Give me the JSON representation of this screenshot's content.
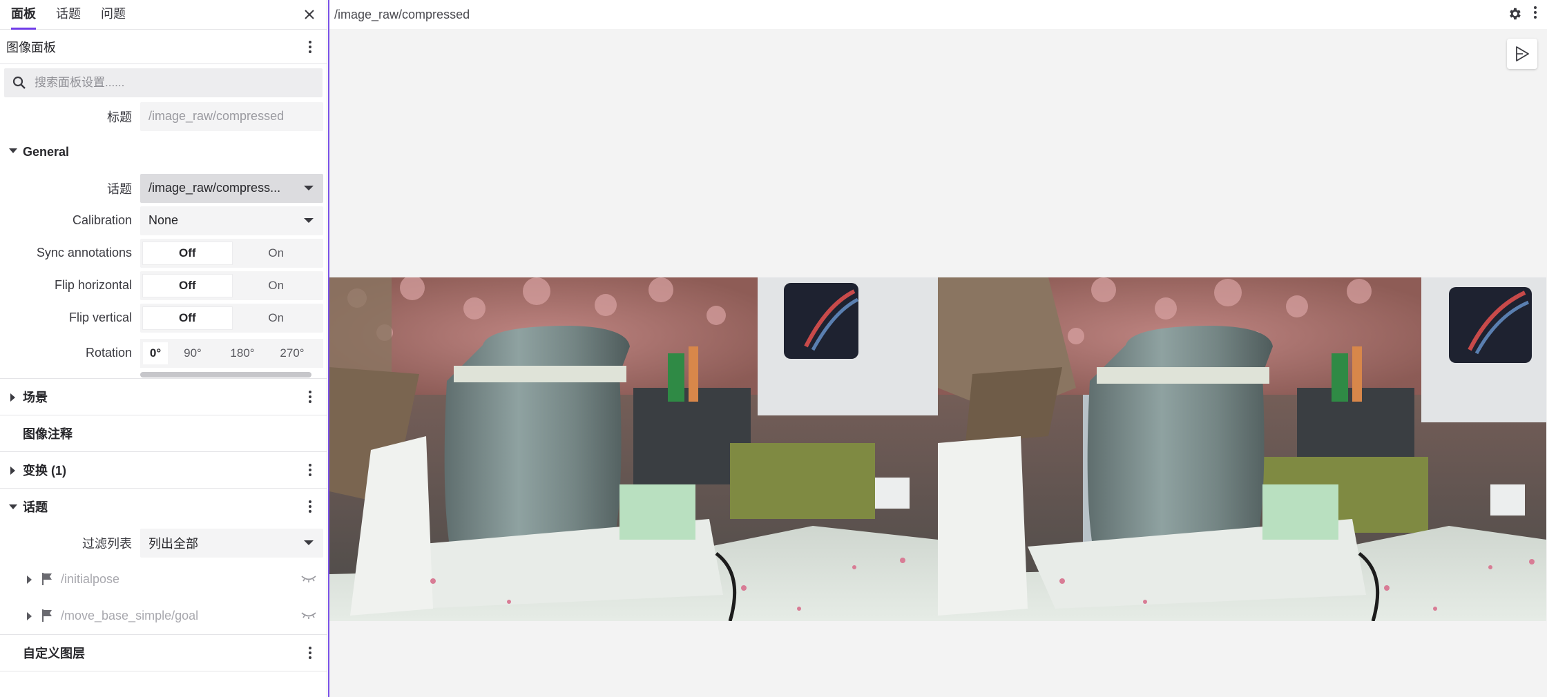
{
  "sidebar": {
    "tabs": [
      "面板",
      "话题",
      "问题"
    ],
    "panel_title": "图像面板",
    "search_placeholder": "搜索面板设置......",
    "title_field": {
      "label": "标题",
      "placeholder": "/image_raw/compressed"
    },
    "general": {
      "title": "General",
      "topic": {
        "label": "话题",
        "value": "/image_raw/compress..."
      },
      "calibration": {
        "label": "Calibration",
        "value": "None"
      },
      "sync": {
        "label": "Sync annotations",
        "off": "Off",
        "on": "On"
      },
      "flip_h": {
        "label": "Flip horizontal",
        "off": "Off",
        "on": "On"
      },
      "flip_v": {
        "label": "Flip vertical",
        "off": "Off",
        "on": "On"
      },
      "rotation": {
        "label": "Rotation",
        "options": [
          "0°",
          "90°",
          "180°",
          "270°"
        ]
      }
    },
    "scene": {
      "title": "场景"
    },
    "annotations": {
      "title": "图像注释"
    },
    "transforms": {
      "title": "变换 (1)"
    },
    "topics": {
      "title": "话题",
      "filter": {
        "label": "过滤列表",
        "value": "列出全部"
      },
      "items": [
        "/initialpose",
        "/move_base_simple/goal"
      ]
    },
    "custom_layers": {
      "title": "自定义图层"
    }
  },
  "main": {
    "title": "/image_raw/compressed"
  },
  "colors": {
    "accent": "#6f3be8",
    "panel_border": "#7a52e8",
    "background": "#f3f3f3"
  }
}
